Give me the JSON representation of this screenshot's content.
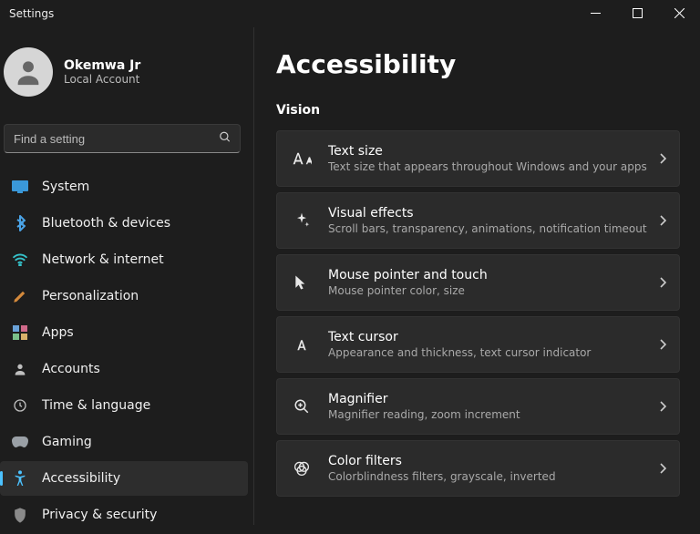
{
  "window": {
    "title": "Settings"
  },
  "user": {
    "name": "Okemwa Jr",
    "type": "Local Account"
  },
  "search": {
    "placeholder": "Find a setting"
  },
  "nav": {
    "items": [
      {
        "label": "System"
      },
      {
        "label": "Bluetooth & devices"
      },
      {
        "label": "Network & internet"
      },
      {
        "label": "Personalization"
      },
      {
        "label": "Apps"
      },
      {
        "label": "Accounts"
      },
      {
        "label": "Time & language"
      },
      {
        "label": "Gaming"
      },
      {
        "label": "Accessibility"
      },
      {
        "label": "Privacy & security"
      }
    ]
  },
  "page": {
    "title": "Accessibility",
    "section": "Vision",
    "cards": [
      {
        "title": "Text size",
        "sub": "Text size that appears throughout Windows and your apps"
      },
      {
        "title": "Visual effects",
        "sub": "Scroll bars, transparency, animations, notification timeout"
      },
      {
        "title": "Mouse pointer and touch",
        "sub": "Mouse pointer color, size"
      },
      {
        "title": "Text cursor",
        "sub": "Appearance and thickness, text cursor indicator"
      },
      {
        "title": "Magnifier",
        "sub": "Magnifier reading, zoom increment"
      },
      {
        "title": "Color filters",
        "sub": "Colorblindness filters, grayscale, inverted"
      }
    ]
  }
}
